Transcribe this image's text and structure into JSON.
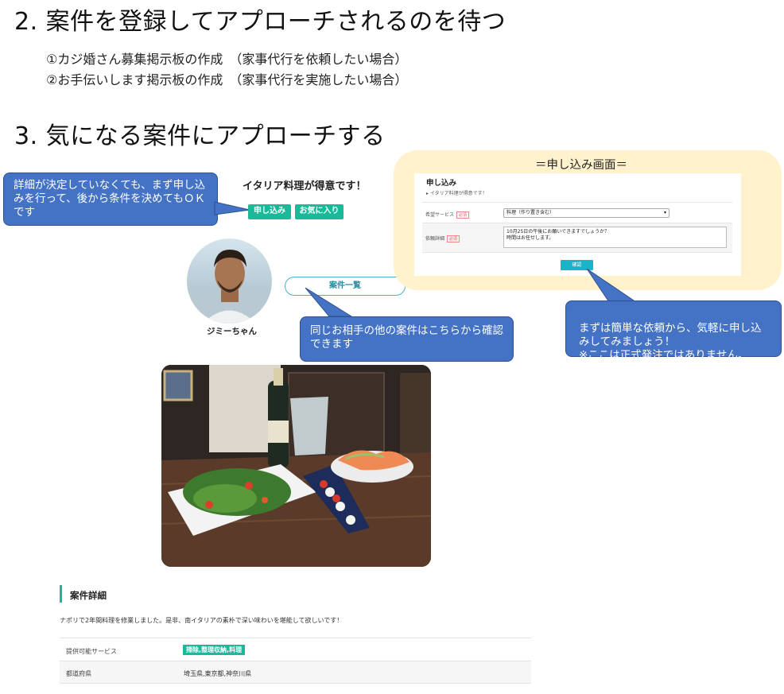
{
  "step2": {
    "heading": "2. 案件を登録してアプローチされるのを待つ",
    "items": [
      "①カジ婚さん募集掲示板の作成　（家事代行を依頼したい場合）",
      "②お手伝いします掲示板の作成　（家事代行を実施したい場合）"
    ]
  },
  "step3": {
    "heading": "3. 気になる案件にアプローチする"
  },
  "callouts": {
    "left": "詳細が決定していなくても、まず申し込みを行って、後から条件を決めてもＯＫです",
    "middle": "同じお相手の他の案件はこちらから確認できます",
    "right": "まずは簡単な依頼から、気軽に申し込みしてみましょう！\n※ここは正式発注ではありません。"
  },
  "listing": {
    "title": "イタリア料理が得意です！",
    "apply_label": "申し込み",
    "favorite_label": "お気に入り",
    "user_name": "ジミーちゃん",
    "cases_link": "案件一覧"
  },
  "apply_screen": {
    "label": "＝申し込み画面＝",
    "title": "申し込み",
    "breadcrumb": "▸ イタリア料理が得意です！",
    "service_label": "希望サービス",
    "service_value": "料理（作り置き含む）",
    "detail_label": "依頼詳細",
    "required": "必須",
    "detail_text": "10月25日の午後にお願いできますでしょうか？\n時間はお任せします。",
    "confirm_label": "確認"
  },
  "details": {
    "heading": "案件詳細",
    "description": "ナポリで2年間料理を修業しました。是非、南イタリアの素朴で深い味わいを堪能して欲しいです！",
    "rows": [
      {
        "label": "提供可能サービス",
        "value": "掃除,整理収納,料理"
      },
      {
        "label": "都道府県",
        "value": "埼玉県,東京都,神奈川県"
      }
    ]
  },
  "colors": {
    "accent": "#19b99a",
    "callout": "#4472c4",
    "panel": "#fff2cc",
    "link": "#4ab3c7"
  },
  "icons": {
    "avatar": "person-avatar",
    "photo": "food-photo-image"
  }
}
